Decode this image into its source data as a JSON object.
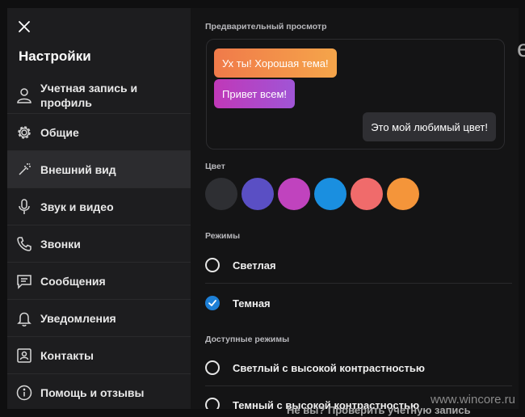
{
  "sidebar": {
    "title": "Настройки",
    "items": [
      {
        "label": "Учетная запись и профиль",
        "icon": "person-icon"
      },
      {
        "label": "Общие",
        "icon": "gear-icon"
      },
      {
        "label": "Внешний вид",
        "icon": "magic-wand-icon",
        "active": true
      },
      {
        "label": "Звук и видео",
        "icon": "microphone-icon"
      },
      {
        "label": "Звонки",
        "icon": "phone-icon"
      },
      {
        "label": "Сообщения",
        "icon": "chat-icon"
      },
      {
        "label": "Уведомления",
        "icon": "bell-icon"
      },
      {
        "label": "Контакты",
        "icon": "contacts-icon"
      },
      {
        "label": "Помощь и отзывы",
        "icon": "info-icon"
      }
    ]
  },
  "preview": {
    "label": "Предварительный просмотр",
    "bubble1": "Ух ты! Хорошая тема!",
    "bubble2": "Привет всем!",
    "bubble3": "Это мой любимый цвет!"
  },
  "color": {
    "label": "Цвет",
    "swatches": [
      "#2e2f33",
      "#5a4fc4",
      "#c043be",
      "#1a8fe0",
      "#f06b6b",
      "#f4953a"
    ]
  },
  "modes": {
    "label": "Режимы",
    "options": [
      {
        "label": "Светлая",
        "checked": false
      },
      {
        "label": "Темная",
        "checked": true
      }
    ]
  },
  "available": {
    "label": "Доступные режимы",
    "options": [
      {
        "label": "Светлый с высокой контрастностью",
        "checked": false
      },
      {
        "label": "Темный с высокой контрастностью",
        "checked": false
      }
    ]
  },
  "background": {
    "letter": "e",
    "bottom_text": "Не вы? Проверить учетную запись"
  },
  "watermark": "www.wincore.ru",
  "colors": {
    "accent": "#1d7fd6",
    "active_bg": "#2c2c2f"
  }
}
